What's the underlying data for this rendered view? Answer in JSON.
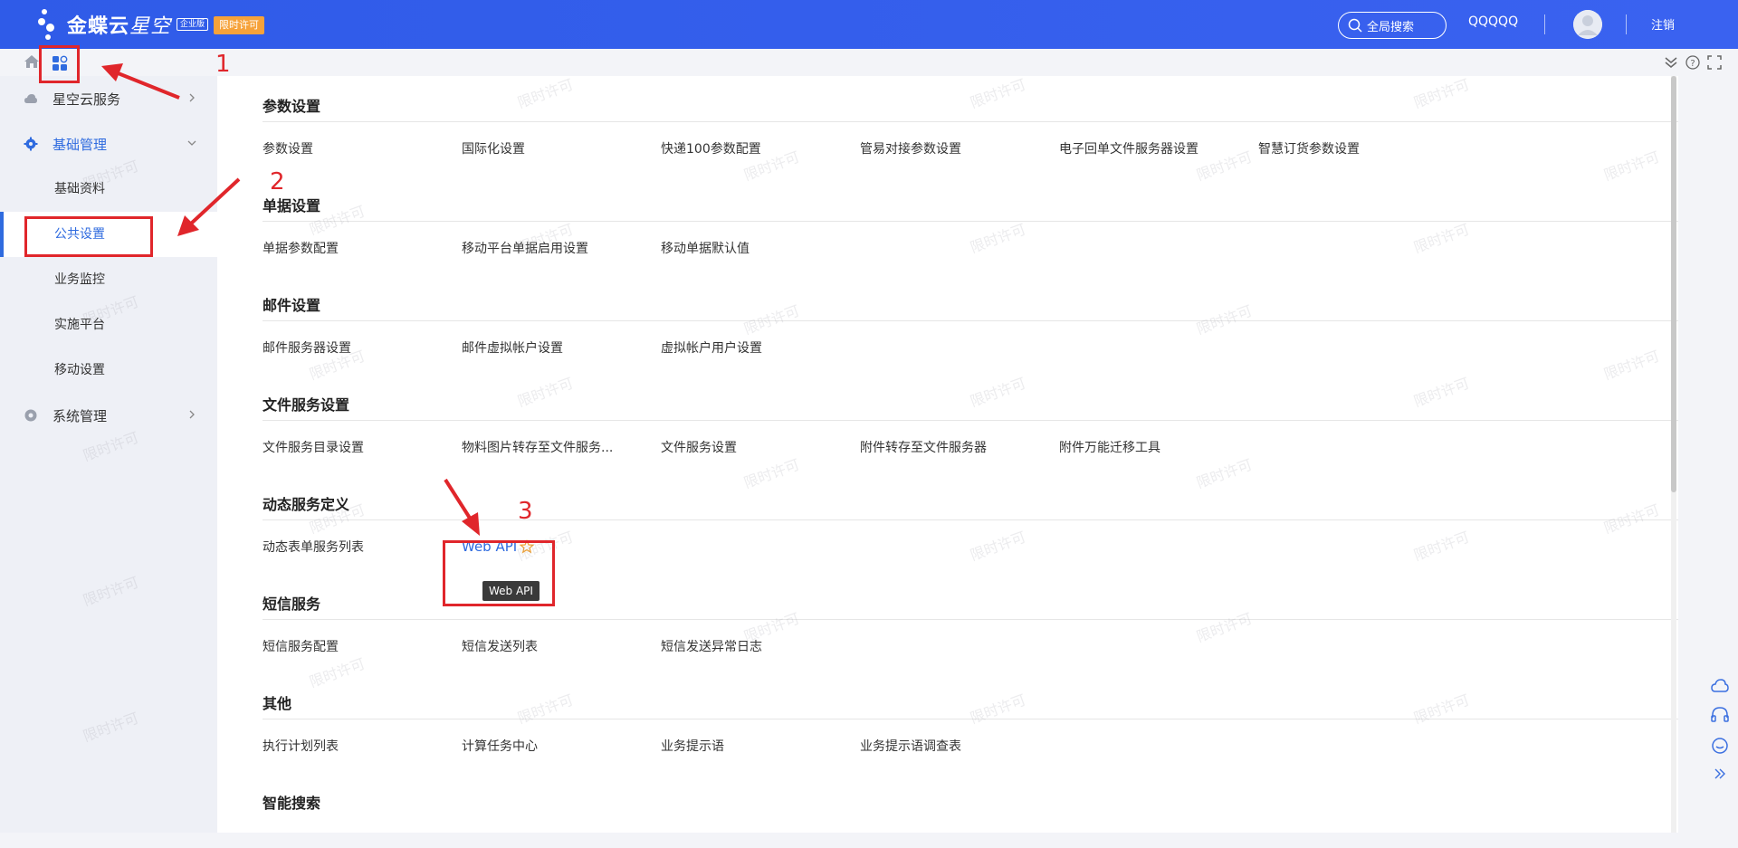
{
  "header": {
    "logo_text": "金蝶云",
    "logo_text_light": "星空",
    "edition": "企业版",
    "license_badge": "限时许可",
    "search_label": "全局搜索",
    "user": "QQQQQ",
    "logout": "注销"
  },
  "watermark_text": "限时许可",
  "sidebar": {
    "groups": [
      {
        "label": "星空云服务",
        "icon": "cloud-icon"
      },
      {
        "label": "基础管理",
        "icon": "gear-icon"
      },
      {
        "label": "系统管理",
        "icon": "settings-icon"
      }
    ],
    "items": [
      "基础资料",
      "公共设置",
      "业务监控",
      "实施平台",
      "移动设置"
    ]
  },
  "sections": [
    {
      "title": "参数设置",
      "items": [
        "参数设置",
        "国际化设置",
        "快递100参数配置",
        "管易对接参数设置",
        "电子回单文件服务器设置",
        "智慧订货参数设置"
      ]
    },
    {
      "title": "单据设置",
      "items": [
        "单据参数配置",
        "移动平台单据启用设置",
        "移动单据默认值"
      ]
    },
    {
      "title": "邮件设置",
      "items": [
        "邮件服务器设置",
        "邮件虚拟帐户设置",
        "虚拟帐户用户设置"
      ]
    },
    {
      "title": "文件服务设置",
      "items": [
        "文件服务目录设置",
        "物料图片转存至文件服务...",
        "文件服务设置",
        "附件转存至文件服务器",
        "附件万能迁移工具"
      ]
    },
    {
      "title": "动态服务定义",
      "items": [
        "动态表单服务列表",
        "Web API"
      ]
    },
    {
      "title": "短信服务",
      "items": [
        "短信服务配置",
        "短信发送列表",
        "短信发送异常日志"
      ]
    },
    {
      "title": "其他",
      "items": [
        "执行计划列表",
        "计算任务中心",
        "业务提示语",
        "业务提示语调查表"
      ]
    },
    {
      "title": "智能搜索",
      "items": []
    }
  ],
  "tooltip": "Web API",
  "annotations": [
    "1",
    "2",
    "3"
  ],
  "colors": {
    "header": "#2f5be8",
    "accent": "#2f6bdf",
    "annotation": "#e0262b",
    "badge": "#f6a23a"
  }
}
